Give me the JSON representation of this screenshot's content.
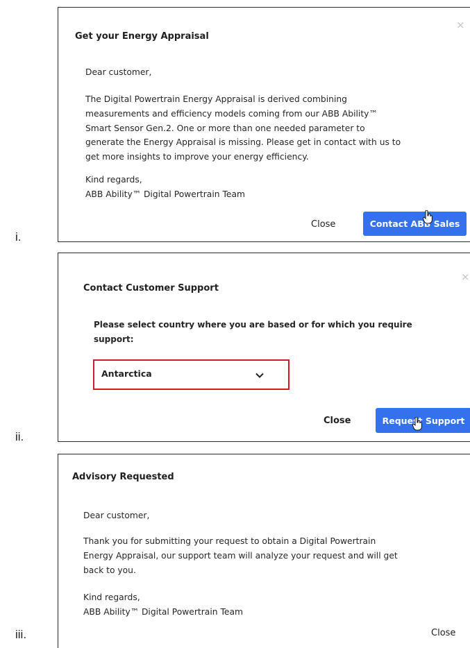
{
  "labels": [
    "i.",
    "ii.",
    "iii."
  ],
  "panel1": {
    "title": "Get your Energy Appraisal",
    "greeting": "Dear customer,",
    "body_lines": [
      "The Digital Powertrain Energy Appraisal is derived combining",
      "measurements and efficiency models coming from our ABB Ability™",
      "Smart Sensor Gen.2. One or more than one needed parameter to",
      "generate the Energy Appraisal is missing. Please get in contact with us to",
      "get more insights to improve your energy efficiency."
    ],
    "closing_lines": [
      "Kind regards,",
      "ABB Ability™ Digital Powertrain Team"
    ],
    "close_label": "Close",
    "primary_label": "Contact ABB Sales",
    "close_icon": "×"
  },
  "panel2": {
    "title": "Contact Customer Support",
    "prompt_lines": [
      "Please select country where you are based or for which you require",
      "support:"
    ],
    "country_value": "Antarctica",
    "close_label": "Close",
    "primary_label": "Request Support",
    "close_icon": "×"
  },
  "panel3": {
    "title": "Advisory Requested",
    "greeting": "Dear customer,",
    "body_lines": [
      "Thank you for submitting your request to obtain a Digital Powertrain",
      "Energy Appraisal, our support team will analyze your request and will get",
      "back to you."
    ],
    "closing_lines": [
      "Kind regards,",
      "ABB Ability™ Digital Powertrain Team"
    ],
    "close_label": "Close"
  },
  "colors": {
    "primary": "#3471ed",
    "highlight": "#d01c23"
  }
}
